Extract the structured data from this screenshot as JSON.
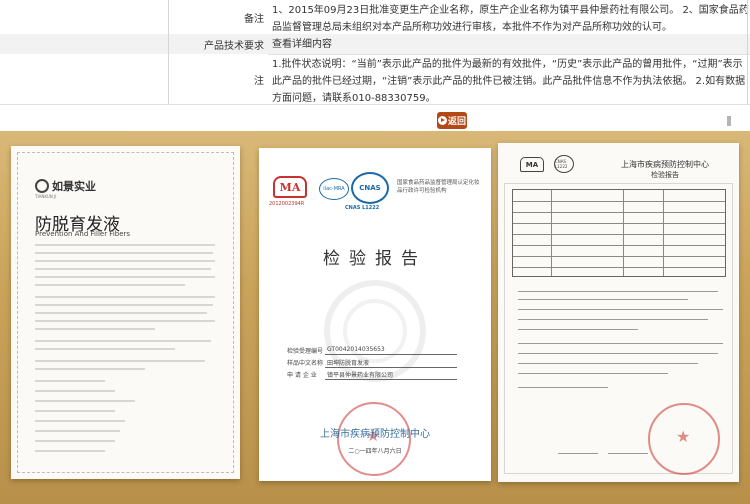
{
  "info": {
    "rows": [
      {
        "label": "备注",
        "value": "1、2015年09月23日批准变更生产企业名称，原生产企业名称为镇平县仲景药社有限公司。  2、国家食品药品监督管理总局未组织对本产品所称功效进行审核，本批件不作为对产品所称功效的认可。"
      },
      {
        "label": "产品技术要求",
        "value": "查看详细内容"
      },
      {
        "label": "注",
        "value": "1.批件状态说明：“当前”表示此产品的批件为最新的有效批件，“历史”表示此产品的曾用批件，“过期”表示此产品的批件已经过期，“注销”表示此产品的批件已被注销。此产品批件信息不作为执法依据。  2.如有数据方面问题，请联系010-88330759。"
      }
    ],
    "back_label": "返回"
  },
  "doc1": {
    "logo_text": "如景实业",
    "logo_sub": "TIANKUN JI",
    "title": "防脱育发液",
    "subtitle": "Prevention And Filler Fibers"
  },
  "doc2": {
    "ma_label": "MA",
    "ma_number": "2012002394R",
    "ilac_label": "ilac-MRA",
    "cnas_label": "CNAS",
    "cnas_number": "CNAS L1222",
    "org_text": "国家食品药品监督管理局认定化妆品行政许可检验机构",
    "title": "检验报告",
    "fields": [
      {
        "key": "检验受理编号",
        "value": "GT0042014035653"
      },
      {
        "key": "样品中文名称",
        "value": "田坤防脱育发液"
      },
      {
        "key": "申  请  企  业",
        "value": "镇平县仲景药业有限公司"
      }
    ],
    "issuer": "上海市疾病预防控制中心",
    "date": "二○一四年八月六日"
  },
  "doc3": {
    "ma_label": "MA",
    "cnas_label": "CNAS L1222",
    "org_title": "上海市疾病预防控制中心",
    "report_title": "检验报告"
  }
}
